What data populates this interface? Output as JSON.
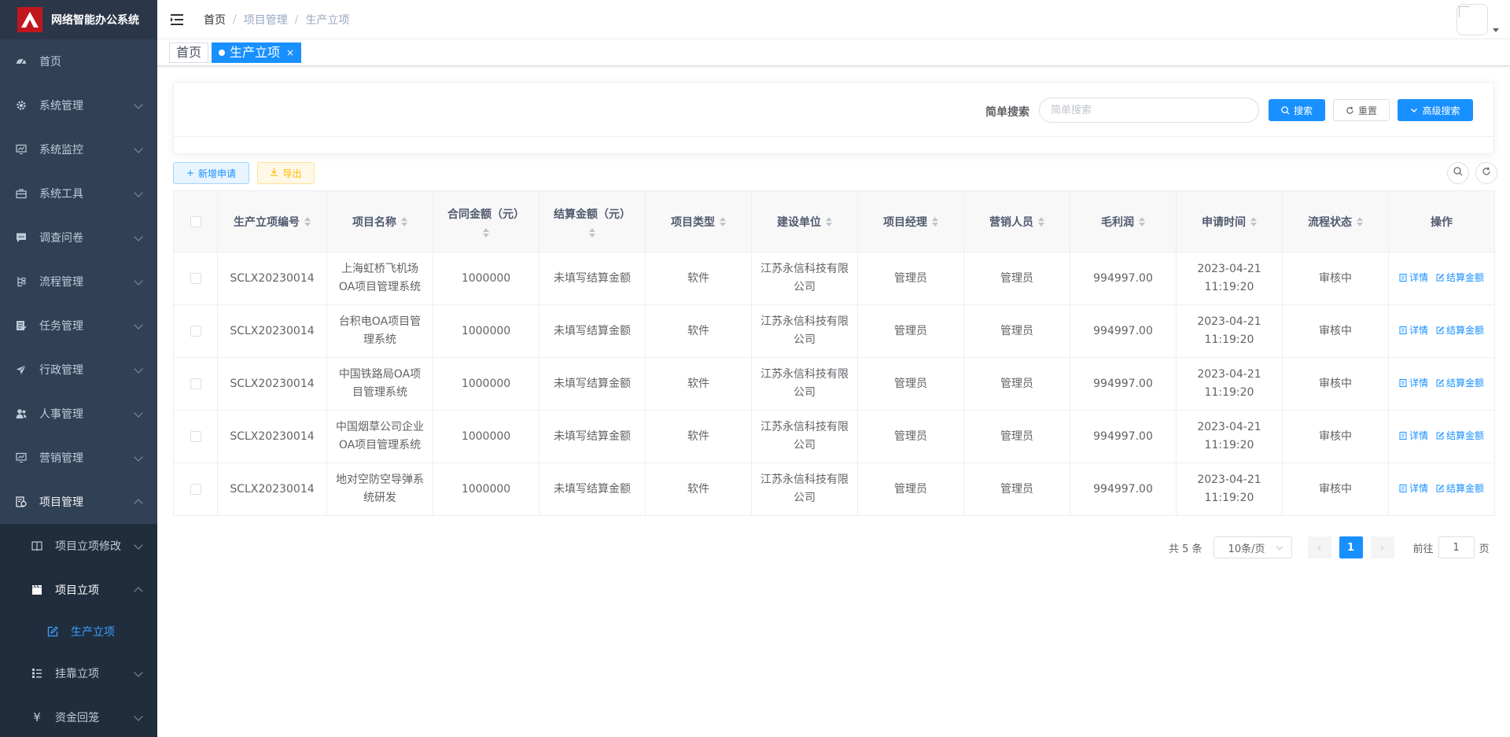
{
  "app": {
    "title": "网络智能办公系统",
    "brand_color": "#c0171d"
  },
  "sidebar": {
    "items": [
      {
        "label": "首页",
        "icon": "dashboard-icon"
      },
      {
        "label": "系统管理",
        "icon": "gear-icon"
      },
      {
        "label": "系统监控",
        "icon": "monitor-icon"
      },
      {
        "label": "系统工具",
        "icon": "toolbox-icon"
      },
      {
        "label": "调查问卷",
        "icon": "chat-icon"
      },
      {
        "label": "流程管理",
        "icon": "flow-icon"
      },
      {
        "label": "任务管理",
        "icon": "task-icon"
      },
      {
        "label": "行政管理",
        "icon": "send-icon"
      },
      {
        "label": "人事管理",
        "icon": "people-icon"
      },
      {
        "label": "营销管理",
        "icon": "chart-icon"
      },
      {
        "label": "项目管理",
        "icon": "project-icon"
      }
    ],
    "sub_items": [
      {
        "label": "项目立项修改",
        "icon": "book-icon"
      },
      {
        "label": "项目立项",
        "icon": "clapper-icon"
      },
      {
        "label": "生产立项",
        "icon": "edit-icon"
      },
      {
        "label": "挂靠立项",
        "icon": "list-icon"
      },
      {
        "label": "资金回笼",
        "icon": "yen-icon"
      }
    ]
  },
  "header": {
    "breadcrumb": [
      "首页",
      "项目管理",
      "生产立项"
    ]
  },
  "tags": [
    {
      "label": "首页"
    },
    {
      "label": "生产立项",
      "close": "×"
    }
  ],
  "search": {
    "label": "简单搜索",
    "placeholder": "简单搜索",
    "value": "",
    "search_btn": "搜索",
    "reset_btn": "重置",
    "advanced_btn": "高级搜索"
  },
  "toolbar": {
    "add_label": "新增申请",
    "export_label": "导出"
  },
  "table": {
    "headers": [
      "生产立项编号",
      "项目名称",
      "合同金额（元）",
      "结算金额（元）",
      "项目类型",
      "建设单位",
      "项目经理",
      "营销人员",
      "毛利润",
      "申请时间",
      "流程状态",
      "操作"
    ],
    "rows": [
      [
        "SCLX20230014",
        "上海虹桥飞机场OA项目管理系统",
        "1000000",
        "未填写结算金额",
        "软件",
        "江苏永信科技有限公司",
        "管理员",
        "管理员",
        "994997.00",
        "2023-04-21 11:19:20",
        "审核中"
      ],
      [
        "SCLX20230014",
        "台积电OA项目管理系统",
        "1000000",
        "未填写结算金额",
        "软件",
        "江苏永信科技有限公司",
        "管理员",
        "管理员",
        "994997.00",
        "2023-04-21 11:19:20",
        "审核中"
      ],
      [
        "SCLX20230014",
        "中国铁路局OA项目管理系统",
        "1000000",
        "未填写结算金额",
        "软件",
        "江苏永信科技有限公司",
        "管理员",
        "管理员",
        "994997.00",
        "2023-04-21 11:19:20",
        "审核中"
      ],
      [
        "SCLX20230014",
        "中国烟草公司企业OA项目管理系统",
        "1000000",
        "未填写结算金额",
        "软件",
        "江苏永信科技有限公司",
        "管理员",
        "管理员",
        "994997.00",
        "2023-04-21 11:19:20",
        "审核中"
      ],
      [
        "SCLX20230014",
        "地对空防空导弹系统研发",
        "1000000",
        "未填写结算金额",
        "软件",
        "江苏永信科技有限公司",
        "管理员",
        "管理员",
        "994997.00",
        "2023-04-21 11:19:20",
        "审核中"
      ]
    ],
    "row_actions": {
      "detail": "详情",
      "settle": "结算金额"
    }
  },
  "pagination": {
    "total_text": "共 5 条",
    "page_size": "10条/页",
    "current_page": "1",
    "goto_prefix": "前往",
    "goto_value": "1",
    "goto_suffix": "页"
  },
  "colors": {
    "primary": "#1890ff",
    "sidebar_bg": "#304156",
    "submenu_bg": "#1f2d3d",
    "warning": "#ffba00"
  }
}
